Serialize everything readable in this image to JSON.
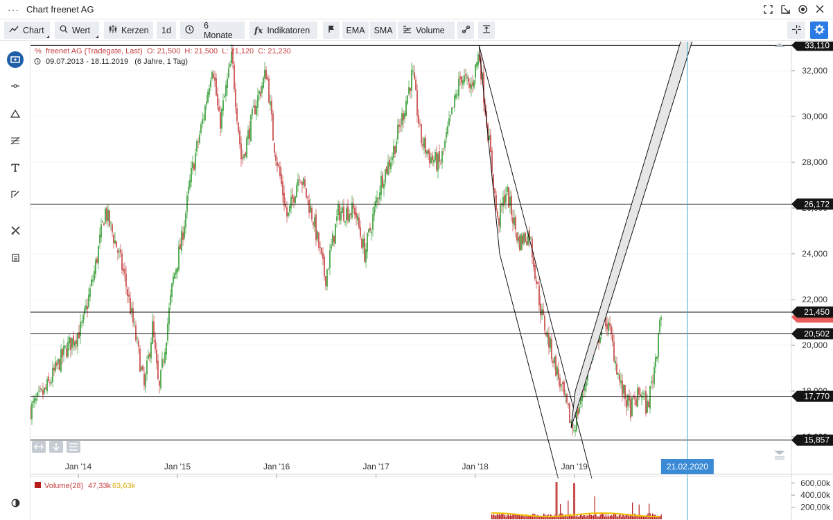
{
  "window": {
    "menu_icon": "ellipsis-icon",
    "title": "Chart freenet AG",
    "actions": [
      "fullscreen-icon",
      "popout-icon",
      "record-icon",
      "close-icon"
    ]
  },
  "toolbar": {
    "chart_label": "Chart",
    "wert_label": "Wert",
    "kerzen_label": "Kerzen",
    "interval_label": "1d",
    "range_label": "6 Monate",
    "indicators_label": "Indikatoren",
    "ema_label": "EMA",
    "sma_label": "SMA",
    "volume_label": "Volume"
  },
  "sidebar": {
    "tools": [
      "chart-type-icon",
      "line-tool-icon",
      "triangle-icon",
      "fibonacci-icon",
      "text-icon",
      "pencil-icon",
      "tools-icon",
      "calculator-icon",
      "contrast-icon"
    ]
  },
  "legend": {
    "name": "freenet AG (Tradegate, Last)",
    "ohlc": "O: 21,500  H: 21,500  L: 21,120  C: 21,230",
    "period": "09.07.2013 - 18.11.2019   (6 Jahre, 1 Tag)",
    "volume_name": "Volume(28)",
    "volume_value": "47,33k",
    "volume_avg": "63,63k"
  },
  "cursor": {
    "date_label": "21.02.2020"
  },
  "colors": {
    "up": "#2e9a2e",
    "down": "#c43c3c",
    "tag": "#141414",
    "current_price": "#e85c5c",
    "crosshair": "#3aa8c8",
    "cursor_tag": "#3a8ad6",
    "volume_bar": "#b71c1c",
    "volume_avg": "#f2c200"
  },
  "chart_data": {
    "type": "candlestick",
    "title": "freenet AG (Tradegate, Last)",
    "x_axis": {
      "ticks": [
        "Jan '14",
        "Jan '15",
        "Jan '16",
        "Jan '17",
        "Jan '18",
        "Jan '19"
      ]
    },
    "y_axis": {
      "ticks": [
        "16,000",
        "18,000",
        "20,000",
        "22,000",
        "24,000",
        "26,000",
        "28,000",
        "30,000",
        "32,000"
      ],
      "min": 15.4,
      "max": 33.6
    },
    "volume_axis": {
      "ticks": [
        "600,00k",
        "400,00k",
        "200,00k"
      ]
    },
    "current_price": 21.23,
    "last_bar": {
      "open": 21.5,
      "high": 21.5,
      "low": 21.12,
      "close": 21.23
    },
    "price_path": [
      [
        "2013-07-09",
        17.2
      ],
      [
        "2013-09-01",
        18.0
      ],
      [
        "2013-11-15",
        19.8
      ],
      [
        "2014-01-15",
        20.8
      ],
      [
        "2014-03-01",
        23.2
      ],
      [
        "2014-04-10",
        25.9
      ],
      [
        "2014-05-20",
        24.4
      ],
      [
        "2014-06-20",
        23.0
      ],
      [
        "2014-08-10",
        19.7
      ],
      [
        "2014-09-01",
        18.1
      ],
      [
        "2014-10-01",
        20.8
      ],
      [
        "2014-10-25",
        17.9
      ],
      [
        "2014-12-15",
        22.8
      ],
      [
        "2015-01-15",
        24.5
      ],
      [
        "2015-02-20",
        27.4
      ],
      [
        "2015-04-10",
        30.2
      ],
      [
        "2015-05-10",
        32.4
      ],
      [
        "2015-06-05",
        29.6
      ],
      [
        "2015-07-20",
        32.6
      ],
      [
        "2015-08-25",
        28.0
      ],
      [
        "2015-10-15",
        30.5
      ],
      [
        "2015-11-25",
        32.0
      ],
      [
        "2015-12-20",
        29.0
      ],
      [
        "2016-02-10",
        25.5
      ],
      [
        "2016-03-25",
        27.6
      ],
      [
        "2016-05-15",
        25.5
      ],
      [
        "2016-06-28",
        22.9
      ],
      [
        "2016-08-15",
        25.8
      ],
      [
        "2016-10-15",
        25.9
      ],
      [
        "2016-11-20",
        24.0
      ],
      [
        "2017-01-20",
        27.2
      ],
      [
        "2017-03-01",
        28.3
      ],
      [
        "2017-04-10",
        30.1
      ],
      [
        "2017-05-15",
        31.9
      ],
      [
        "2017-06-15",
        29.0
      ],
      [
        "2017-07-20",
        28.2
      ],
      [
        "2017-08-25",
        27.9
      ],
      [
        "2017-10-01",
        29.8
      ],
      [
        "2017-11-10",
        31.8
      ],
      [
        "2017-12-15",
        31.2
      ],
      [
        "2018-01-15",
        32.8
      ],
      [
        "2018-02-20",
        29.0
      ],
      [
        "2018-03-25",
        25.3
      ],
      [
        "2018-04-25",
        26.8
      ],
      [
        "2018-06-10",
        24.5
      ],
      [
        "2018-07-20",
        24.9
      ],
      [
        "2018-09-01",
        21.4
      ],
      [
        "2018-10-25",
        19.0
      ],
      [
        "2018-12-05",
        17.2
      ],
      [
        "2018-12-28",
        16.3
      ],
      [
        "2019-02-01",
        18.0
      ],
      [
        "2019-03-01",
        19.4
      ],
      [
        "2019-04-01",
        20.4
      ],
      [
        "2019-04-20",
        21.4
      ],
      [
        "2019-05-15",
        20.4
      ],
      [
        "2019-06-20",
        18.2
      ],
      [
        "2019-07-25",
        17.2
      ],
      [
        "2019-08-15",
        17.6
      ],
      [
        "2019-09-05",
        18.0
      ],
      [
        "2019-09-25",
        17.2
      ],
      [
        "2019-10-15",
        18.5
      ],
      [
        "2019-11-01",
        19.9
      ],
      [
        "2019-11-12",
        21.4
      ],
      [
        "2019-11-18",
        21.23
      ]
    ],
    "horizontal_lines": [
      {
        "value": 33.11,
        "label": "33,110"
      },
      {
        "value": 26.172,
        "label": "26,172"
      },
      {
        "value": 21.45,
        "label": "21,450"
      },
      {
        "value": 20.502,
        "label": "20,502"
      },
      {
        "value": 17.77,
        "label": "17,770"
      },
      {
        "value": 15.857,
        "label": "15,857"
      }
    ],
    "trend_channels": [
      {
        "type": "down",
        "p1": [
          "2018-01-15",
          33.11
        ],
        "p2": [
          "2019-01-10",
          16.7
        ],
        "offset_date": [
          "2018-04-01",
          24.0
        ]
      },
      {
        "type": "up",
        "p1": [
          "2018-12-20",
          16.4
        ],
        "p2": [
          "2019-05-01",
          21.4
        ],
        "width": 1.6
      }
    ],
    "cursor_date": "2020-02-21"
  }
}
